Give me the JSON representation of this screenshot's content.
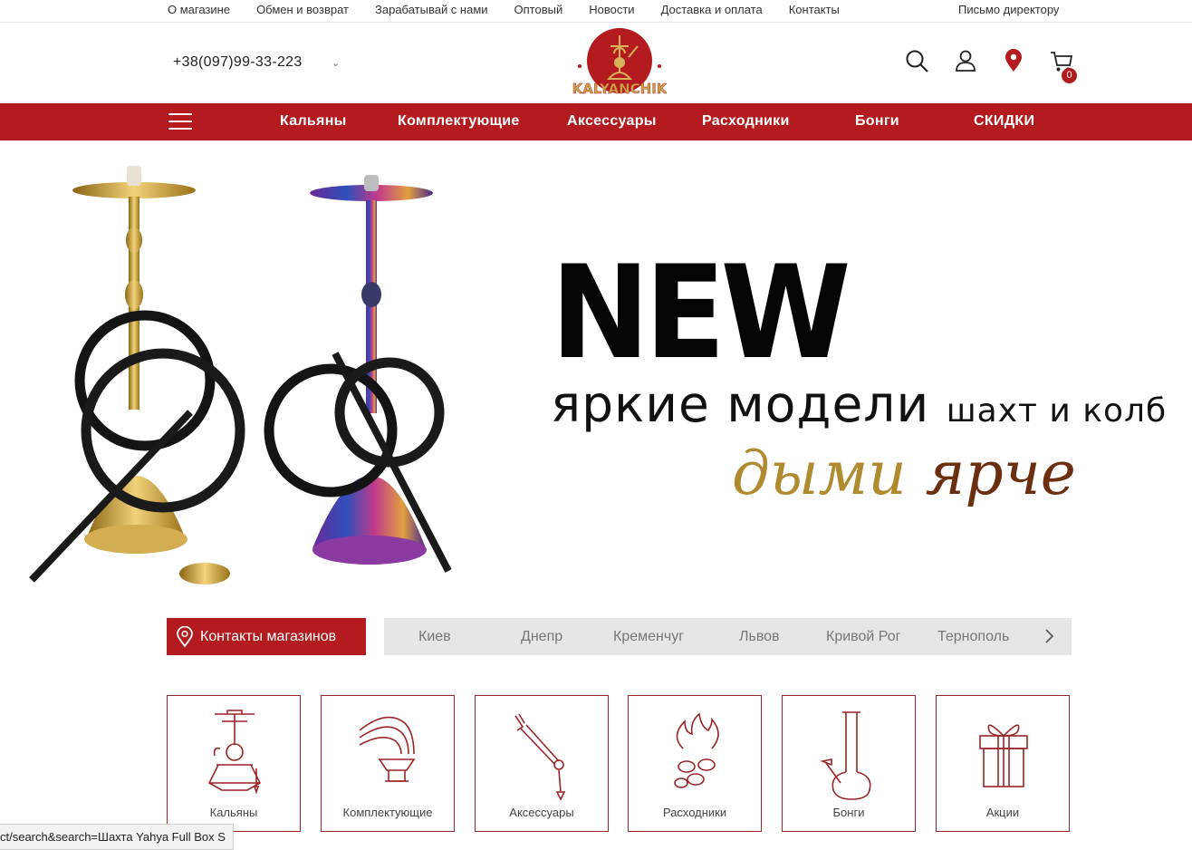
{
  "top_links": [
    "О магазине",
    "Обмен и возврат",
    "Зарабатывай с нами",
    "Оптовый",
    "Новости",
    "Доставка и оплата",
    "Контакты"
  ],
  "director_link": "Письмо директору",
  "header": {
    "phone": "+38(097)99-33-223",
    "logo_text": "KALYANCHIK",
    "cart_count": "0"
  },
  "nav": [
    "Кальяны",
    "Комплектующие",
    "Аксессуары",
    "Расходники",
    "Бонги",
    "СКИДКИ"
  ],
  "hero": {
    "headline": "NEW",
    "line2_big": "яркие модели",
    "line2_small": "шахт и колб",
    "script_1": "дыми",
    "script_2": "ярче"
  },
  "contacts": {
    "button_label": "Контакты магазинов",
    "cities": [
      "Киев",
      "Днепр",
      "Кременчуг",
      "Львов",
      "Кривой Рог",
      "Тернополь"
    ]
  },
  "categories": [
    "Кальяны",
    "Комплектующие",
    "Аксессуары",
    "Расходники",
    "Бонги",
    "Акции"
  ],
  "status_url": "ct/search&search=Шахта Yahya Full Box S",
  "colors": {
    "brand_red": "#b31b1f",
    "city_bar": "#e6e6e6",
    "gold": "#c9a34a"
  }
}
